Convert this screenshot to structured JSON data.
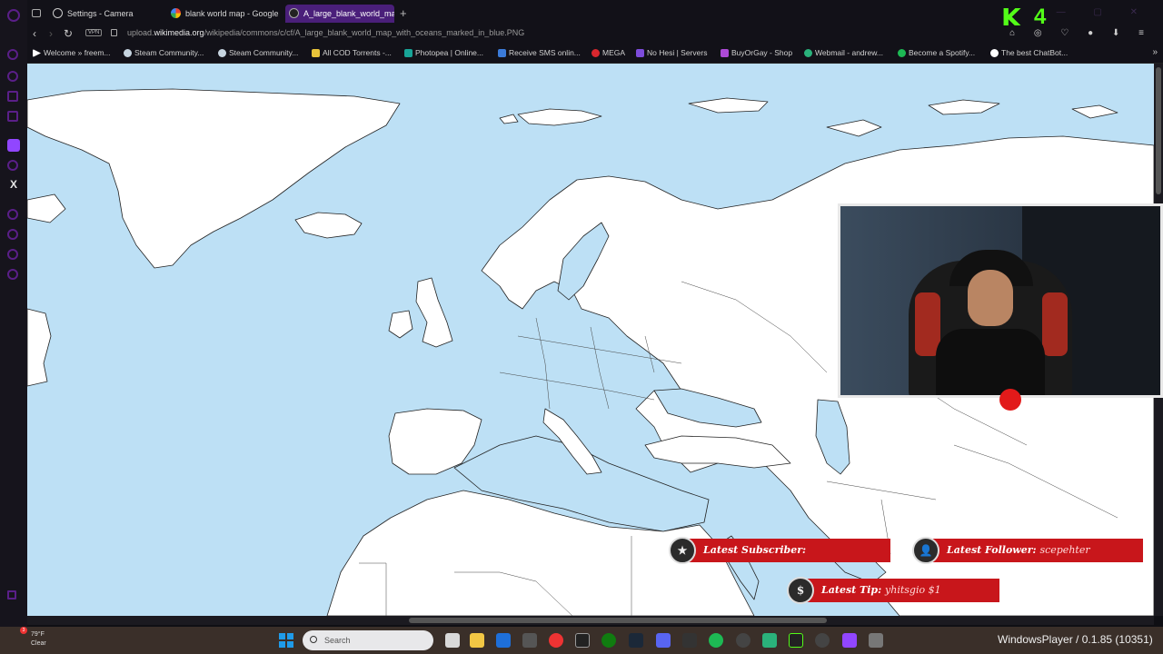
{
  "tabs": [
    {
      "label": "Settings - Camera",
      "active": false
    },
    {
      "label": "blank world map - Google",
      "active": false
    },
    {
      "label": "A_large_blank_world_map",
      "active": true
    }
  ],
  "address": {
    "url_prefix": "upload.",
    "url_host": "wikimedia.org",
    "url_path": "/wikipedia/commons/c/cf/A_large_blank_world_map_with_oceans_marked_in_blue.PNG",
    "vpn_label": "VPN"
  },
  "bookmarks": [
    "Welcome » freem...",
    "Steam Community...",
    "Steam Community...",
    "All COD Torrents -...",
    "Photopea | Online...",
    "Receive SMS onlin...",
    "MEGA",
    "No Hesi | Servers",
    "BuyOrGay - Shop",
    "Webmail - andrew...",
    "Become a Spotify...",
    "The best ChatBot..."
  ],
  "alerts": {
    "subscriber_label": "Latest Subscriber:",
    "subscriber_value": "",
    "follower_label": "Latest Follower:",
    "follower_value": "scepehter",
    "tip_label": "Latest Tip:",
    "tip_value": "yhitsgio $1"
  },
  "taskbar": {
    "search_placeholder": "Search",
    "weather_temp": "79°F",
    "weather_desc": "Clear",
    "weather_badge": "3",
    "player_text": "WindowsPlayer / 0.1.85 (10351)"
  },
  "icons": {
    "sidebar_x": "X",
    "kick_k": "K",
    "kick_number": "4",
    "new_tab": "+",
    "more_bookmarks": "»",
    "back": "‹",
    "forward": "›",
    "reload": "↻",
    "star": "★",
    "person": "👤",
    "dollar": "$",
    "right_toolbar": "⌂ ◎ ♡ ● ⬇ ≡"
  },
  "colors": {
    "ocean": "#bde0f5",
    "land": "#ffffff",
    "accent": "#4a1f7a",
    "alert_red": "#c8161b",
    "kick_green": "#53fc18"
  }
}
